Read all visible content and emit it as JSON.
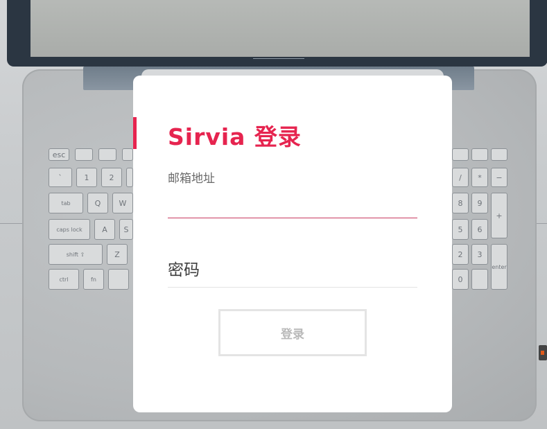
{
  "background": {
    "description_keys": [
      "laptop-photo"
    ],
    "keys": {
      "tab": "tab",
      "caps": "caps lock",
      "shift": "shift ⇧",
      "ctrl": "ctrl",
      "fn": "fn",
      "esc": "esc",
      "q": "Q",
      "w": "W",
      "a": "A",
      "s": "S",
      "z": "Z",
      "one": "1",
      "two": "2",
      "backtick": "`",
      "enter": "enter",
      "plus": "+",
      "minus": "−",
      "star": "*",
      "slash": "/",
      "n8": "8",
      "n9": "9",
      "n5": "5",
      "n6": "6",
      "n2": "2",
      "n3": "3",
      "n0": "0"
    }
  },
  "login": {
    "title": "Sirvia 登录",
    "email_label": "邮箱地址",
    "email_value": "",
    "password_placeholder": "密码",
    "submit_label": "登录"
  },
  "colors": {
    "accent": "#e6244f",
    "button_border": "#e4e4e4",
    "button_text": "#b9b9b9"
  }
}
